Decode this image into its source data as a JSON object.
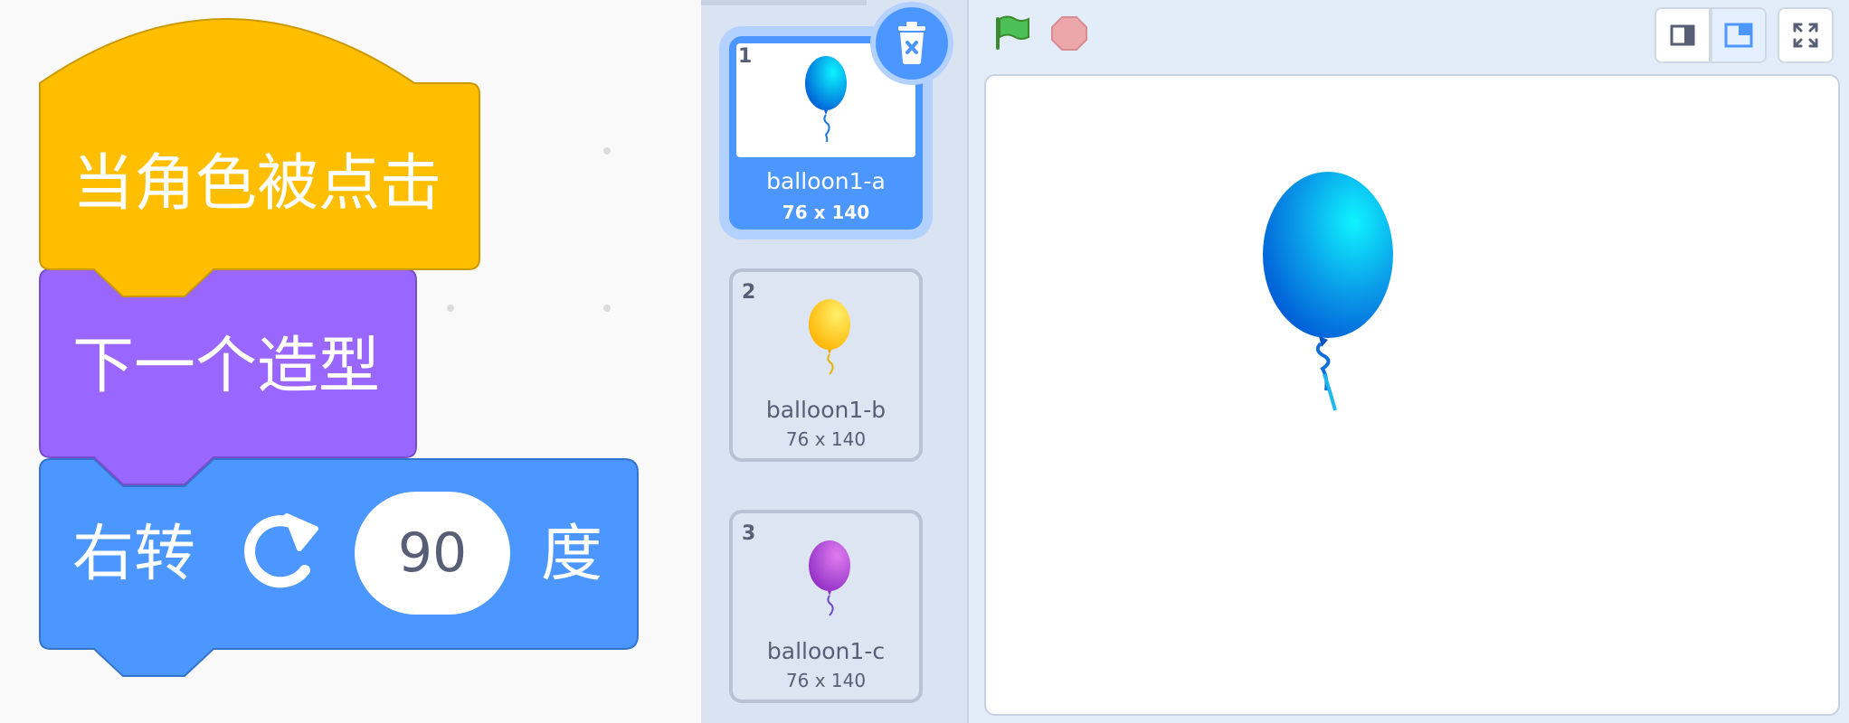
{
  "script": {
    "hat_block_label": "当角色被点击",
    "looks_block_label": "下一个造型",
    "motion_block_prefix": "右转",
    "motion_block_value": "90",
    "motion_block_suffix": "度"
  },
  "costumes": [
    {
      "index": "1",
      "name": "balloon1-a",
      "size": "76 x 140",
      "color": "blue",
      "selected": true
    },
    {
      "index": "2",
      "name": "balloon1-b",
      "size": "76 x 140",
      "color": "yellow",
      "selected": false
    },
    {
      "index": "3",
      "name": "balloon1-c",
      "size": "76 x 140",
      "color": "purple",
      "selected": false
    }
  ],
  "stage": {
    "controls": [
      "green-flag-icon",
      "stop-icon"
    ],
    "layout_buttons": [
      "small-stage-icon",
      "normal-stage-icon",
      "fullscreen-icon"
    ],
    "sprite_costume": "balloon1-a"
  },
  "colors": {
    "events": "#ffbf00",
    "looks": "#9966ff",
    "motion": "#4c97ff",
    "selected_accent": "#4c97ff"
  }
}
